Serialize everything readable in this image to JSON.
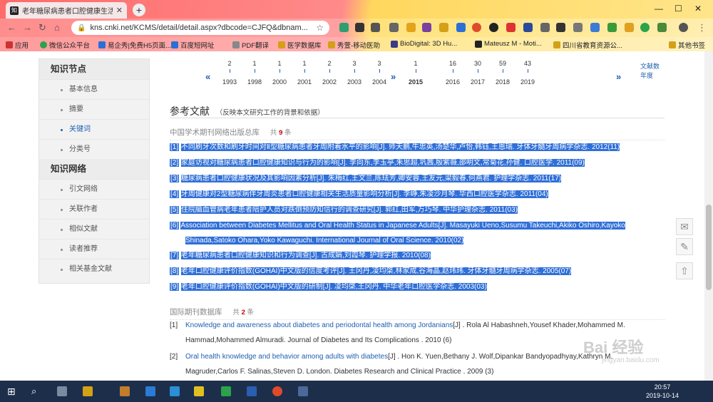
{
  "browser": {
    "tab_title": "老年糖尿病患者口腔健康生活质...",
    "url": "kns.cnki.net/KCMS/detail/detail.aspx?dbcode=CJFQ&dbnam...",
    "bookmarks": [
      "应用",
      "微信公众平台",
      "易企秀|免费H5页面...",
      "百度短网址",
      "PDF翻译",
      "医学数据库",
      "秀萱-移动医助",
      "BioDigital: 3D Hu...",
      "Mateusz M - Moti...",
      "四川省教育资源公...",
      "其他书签"
    ]
  },
  "sidebar": {
    "head1": "知识节点",
    "items1": [
      "基本信息",
      "摘要",
      "关键词",
      "分类号"
    ],
    "head2": "知识网络",
    "items2": [
      "引文网络",
      "关联作者",
      "相似文献",
      "读者推荐",
      "相关基金文献"
    ]
  },
  "years": [
    {
      "y": "1993",
      "c": "2"
    },
    {
      "y": "1998",
      "c": "1"
    },
    {
      "y": "2000",
      "c": "1"
    },
    {
      "y": "2001",
      "c": "1"
    },
    {
      "y": "2002",
      "c": "2"
    },
    {
      "y": "2003",
      "c": "3"
    },
    {
      "y": "2004",
      "c": "3"
    },
    {
      "y": "2015",
      "c": "1"
    },
    {
      "y": "2016",
      "c": "16"
    },
    {
      "y": "2017",
      "c": "30"
    },
    {
      "y": "2018",
      "c": "59"
    },
    {
      "y": "2019",
      "c": "43"
    }
  ],
  "legend": {
    "l1": "文献数",
    "l2": "年度"
  },
  "references": {
    "title": "参考文献",
    "subtitle": "（反映本文研究工作的背景和依据）",
    "db1": {
      "name": "中国学术期刊网络出版总库",
      "count_pre": "共",
      "count": "9",
      "count_post": "条"
    },
    "db1_items": [
      {
        "n": "[1]",
        "t": "不同刷牙次数和刷牙时间对Ⅱ型糖尿病患者牙周附着水平的影响[J]. 师天鹏,牛忠英,汤楚华,卢怡,韩钰,王恩瑞. 牙体牙髓牙周病学杂志. 2012(11)"
      },
      {
        "n": "[2]",
        "t": "家庭访视对糖尿病患者口腔健康知识与行为的影响[J]. 李向东,李玉亭,朱思超,巩茜,殷紫薇,邵明文,常菊花,孙健. 口腔医学. 2011(09)"
      },
      {
        "n": "[3]",
        "t": "糖尿病患者口腔健康状况及其影响因素分析[J]. 朱梅红,王文兰,陈珐芳,卿安蓉,王友元,梁毅春,何燕君. 护理学杂志. 2011(17)"
      },
      {
        "n": "[4]",
        "t": "牙周健康对2型糖尿病伴牙周炎患者口腔健康相关生活质量影响分析[J]. 李峥,朱凌沙月琴. 华西口腔医学杂志. 2011(04)"
      },
      {
        "n": "[5]",
        "t": "住院脑血管病老年患者陪护人员对跌倒预防知信行的调查研究[J]. 郭红,田军,万巧琴. 中华护理杂志. 2011(03)"
      },
      {
        "n": "[6]",
        "t": "Association between Diabetes Mellitus and Oral Health Status in Japanese Adults[J]. Masayuki Ueno,Susumu Takeuchi,Akiko Oshiro,Kayoko",
        "t2": "Shinada,Satoko Ohara,Yoko Kawaguchi. International Journal of Oral Science. 2010(02)"
      },
      {
        "n": "[7]",
        "t": "老年糖尿病患者口腔健康知识和行为调查[J]. 古成娟,刘霞琴. 护理学报. 2010(08)"
      },
      {
        "n": "[8]",
        "t": "老年口腔健康评价指数(GOHAI)中文版的信度考评[J]. 王冈丹,凌均棨,林家成,谷海晶,赵玮玮. 牙体牙髓牙周病学杂志. 2005(07)"
      },
      {
        "n": "[9]",
        "t": "老年口腔健康评价指数(GOHAI)中文版的研制[J]. 凌均棨,王冈丹. 中华老年口腔医学杂志. 2003(03)"
      }
    ],
    "db2": {
      "name": "国际期刊数据库",
      "count_pre": "共",
      "count": "2",
      "count_post": "条"
    },
    "db2_items": [
      {
        "n": "[1]",
        "link": "Knowledge and awareness about diabetes and periodontal health among Jordanians",
        "rest": "[J] . Rola Al Habashneh,Yousef Khader,Mohammed M.",
        "line2": "Hammad,Mohammed Almuradi.  Journal of Diabetes and Its Complications . 2010 (6)"
      },
      {
        "n": "[2]",
        "link": "Oral health knowledge and behavior among adults with diabetes",
        "rest": "[J] . Hon K. Yuen,Bethany J. Wolf,Dipankar Bandyopadhyay,Kathryn M.",
        "line2": "Magruder,Carlos F. Salinas,Steven D. London.  Diabetes Research and Clinical Practice . 2009 (3)"
      }
    ]
  },
  "taskbar": {
    "time": "20:57",
    "date": "2019-10-14"
  },
  "watermark": {
    "text": "Bai 经验",
    "url": "jingyan.baidu.com"
  }
}
